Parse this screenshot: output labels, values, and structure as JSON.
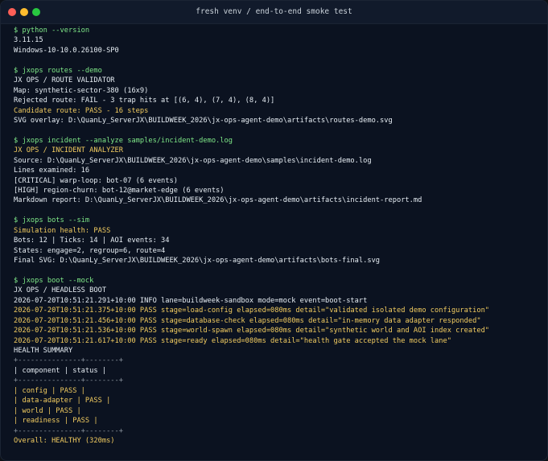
{
  "window": {
    "title": "fresh venv / end-to-end smoke test"
  },
  "colors": {
    "background": "#0b1220",
    "command": "#7ee787",
    "highlight": "#f2cc60",
    "text": "#e6edf3",
    "muted": "#8b949e"
  },
  "terminal": {
    "lines": [
      {
        "type": "cmd",
        "text": "$ python --version"
      },
      {
        "type": "plain",
        "text": "3.11.15"
      },
      {
        "type": "plain",
        "text": "Windows-10-10.0.26100-SP0"
      },
      {
        "type": "blank",
        "text": ""
      },
      {
        "type": "cmd",
        "text": "$ jxops routes --demo"
      },
      {
        "type": "plain",
        "text": "JX OPS / ROUTE VALIDATOR"
      },
      {
        "type": "plain",
        "text": "Map: synthetic-sector-380 (16x9)"
      },
      {
        "type": "plain",
        "text": "Rejected route: FAIL - 3 trap hits at [(6, 4), (7, 4), (8, 4)]"
      },
      {
        "type": "hi",
        "text": "Candidate route: PASS - 16 steps"
      },
      {
        "type": "plain",
        "text": "SVG overlay: D:\\QuanLy_ServerJX\\BUILDWEEK_2026\\jx-ops-agent-demo\\artifacts\\routes-demo.svg"
      },
      {
        "type": "blank",
        "text": ""
      },
      {
        "type": "cmd",
        "text": "$ jxops incident --analyze samples/incident-demo.log"
      },
      {
        "type": "hi",
        "text": "JX OPS / INCIDENT ANALYZER"
      },
      {
        "type": "plain",
        "text": "Source: D:\\QuanLy_ServerJX\\BUILDWEEK_2026\\jx-ops-agent-demo\\samples\\incident-demo.log"
      },
      {
        "type": "plain",
        "text": "Lines examined: 16"
      },
      {
        "type": "plain",
        "text": "[CRITICAL] warp-loop: bot-07 (6 events)"
      },
      {
        "type": "plain",
        "text": "[HIGH] region-churn: bot-12@market-edge (6 events)"
      },
      {
        "type": "plain",
        "text": "Markdown report: D:\\QuanLy_ServerJX\\BUILDWEEK_2026\\jx-ops-agent-demo\\artifacts\\incident-report.md"
      },
      {
        "type": "blank",
        "text": ""
      },
      {
        "type": "cmd",
        "text": "$ jxops bots --sim"
      },
      {
        "type": "hi",
        "text": "Simulation health: PASS"
      },
      {
        "type": "plain",
        "text": "Bots: 12 | Ticks: 14 | AOI events: 34"
      },
      {
        "type": "plain",
        "text": "States: engage=2, regroup=6, route=4"
      },
      {
        "type": "plain",
        "text": "Final SVG: D:\\QuanLy_ServerJX\\BUILDWEEK_2026\\jx-ops-agent-demo\\artifacts\\bots-final.svg"
      },
      {
        "type": "blank",
        "text": ""
      },
      {
        "type": "cmd",
        "text": "$ jxops boot --mock"
      },
      {
        "type": "plain",
        "text": "JX OPS / HEADLESS BOOT"
      },
      {
        "type": "plain",
        "text": "2026-07-20T10:51:21.291+10:00 INFO lane=buildweek-sandbox mode=mock event=boot-start"
      },
      {
        "type": "hi",
        "text": "2026-07-20T10:51:21.375+10:00 PASS stage=load-config elapsed=080ms detail=\"validated isolated demo configuration\""
      },
      {
        "type": "hi",
        "text": "2026-07-20T10:51:21.456+10:00 PASS stage=database-check elapsed=080ms detail=\"in-memory data adapter responded\""
      },
      {
        "type": "hi",
        "text": "2026-07-20T10:51:21.536+10:00 PASS stage=world-spawn elapsed=080ms detail=\"synthetic world and AOI index created\""
      },
      {
        "type": "hi",
        "text": "2026-07-20T10:51:21.617+10:00 PASS stage=ready elapsed=080ms detail=\"health gate accepted the mock lane\""
      },
      {
        "type": "plain",
        "text": "HEALTH SUMMARY"
      },
      {
        "type": "muted",
        "text": "+---------------+--------+"
      },
      {
        "type": "plain",
        "text": "| component | status |"
      },
      {
        "type": "muted",
        "text": "+---------------+--------+"
      },
      {
        "type": "hi",
        "text": "| config | PASS |"
      },
      {
        "type": "hi",
        "text": "| data-adapter | PASS |"
      },
      {
        "type": "hi",
        "text": "| world | PASS |"
      },
      {
        "type": "hi",
        "text": "| readiness | PASS |"
      },
      {
        "type": "muted",
        "text": "+---------------+--------+"
      },
      {
        "type": "hi",
        "text": "Overall: HEALTHY (320ms)"
      }
    ]
  }
}
